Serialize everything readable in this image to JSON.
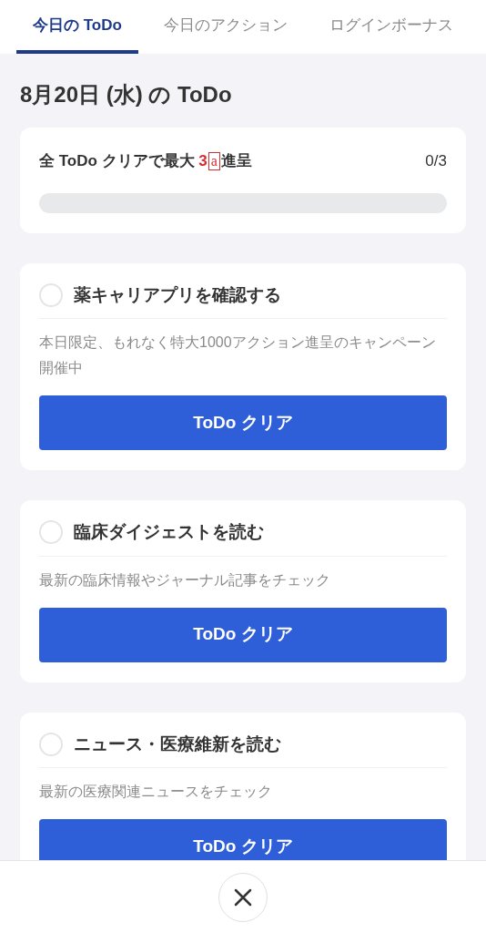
{
  "tabs": [
    {
      "label": "今日の ToDo",
      "selected": true
    },
    {
      "label": "今日のアクション",
      "selected": false
    },
    {
      "label": "ログインボーナス",
      "selected": false
    }
  ],
  "heading": "8月20日 (水) の ToDo",
  "summary": {
    "text_before": "全 ToDo クリアで最大 ",
    "highlight": "3",
    "unit_mark": "a",
    "text_after": "進呈",
    "count": "0/3"
  },
  "todos": [
    {
      "title": "薬キャリアプリを確認する",
      "checked": false,
      "description": "本日限定、もれなく特大1000アクション進呈のキャンペーン開催中",
      "button": "ToDo クリア"
    },
    {
      "title": "臨床ダイジェストを読む",
      "checked": false,
      "description": "最新の臨床情報やジャーナル記事をチェック",
      "button": "ToDo クリア"
    },
    {
      "title": "ニュース・医療維新を読む",
      "checked": false,
      "description": "最新の医療関連ニュースをチェック",
      "button": "ToDo クリア"
    }
  ]
}
